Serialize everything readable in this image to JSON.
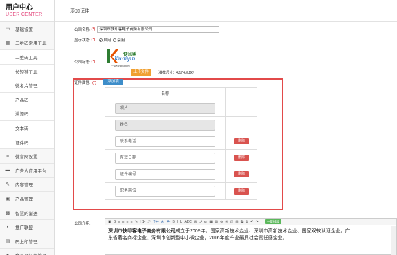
{
  "sidebar": {
    "brand_title": "用户中心",
    "brand_sub": "USER CENTER",
    "items": [
      {
        "label": "基础设置",
        "icon": "monitor-icon",
        "sub": false
      },
      {
        "label": "二维码常用工具",
        "icon": "grid-icon",
        "sub": false
      },
      {
        "label": "二维码工具",
        "icon": "",
        "sub": true
      },
      {
        "label": "长短链工具",
        "icon": "",
        "sub": true
      },
      {
        "label": "微名片管理",
        "icon": "",
        "sub": true
      },
      {
        "label": "产品码",
        "icon": "",
        "sub": true
      },
      {
        "label": "溯源码",
        "icon": "",
        "sub": true
      },
      {
        "label": "文本码",
        "icon": "",
        "sub": true
      },
      {
        "label": "证件码",
        "icon": "",
        "sub": true
      },
      {
        "label": "微官网设置",
        "icon": "list-icon",
        "sub": false
      },
      {
        "label": "广告人应用平台",
        "icon": "book-icon",
        "sub": false
      },
      {
        "label": "内容管理",
        "icon": "edit-icon",
        "sub": false
      },
      {
        "label": "产品管理",
        "icon": "image-icon",
        "sub": false
      },
      {
        "label": "智慧的渐进",
        "icon": "gift-icon",
        "sub": false
      },
      {
        "label": "推广联盟",
        "icon": "lock-icon",
        "sub": false
      },
      {
        "label": "码上印管理",
        "icon": "doc-icon",
        "sub": false
      },
      {
        "label": "会员及证件管理",
        "icon": "user-icon",
        "sub": false
      }
    ]
  },
  "main": {
    "header_title": "添加证件",
    "company_name_label": "公司名称:",
    "required_mark": "(*)",
    "company_name_value": "深圳市快印客电子商务有限公司",
    "display_status_label": "显示状态:",
    "status_enabled": "启用",
    "status_disabled": "禁用",
    "logo_label": "公司标志:",
    "logo_brand": "Kuaiyinke",
    "logo_brand_cn": "快印客",
    "logo_tagline": "一站式全网印刷服务",
    "upload_label": "上传文件",
    "logo_hint": "（推荐尺寸：430*430px）",
    "attr_label": "证件属性:",
    "add_attr_label": "添加项",
    "attr_table_header": "名称",
    "attr_rows": [
      {
        "name": "照片",
        "locked": true,
        "delete_label": ""
      },
      {
        "name": "姓名",
        "locked": true,
        "delete_label": ""
      },
      {
        "name": "联系电话",
        "locked": false,
        "delete_label": "删除"
      },
      {
        "name": "有效日期",
        "locked": false,
        "delete_label": "删除"
      },
      {
        "name": "证件编号",
        "locked": false,
        "delete_label": "删除"
      },
      {
        "name": "职务岗位",
        "locked": false,
        "delete_label": "删除"
      }
    ],
    "intro_label": "公司介绍:",
    "editor_toolbar": [
      "▣",
      "B̲",
      "≡",
      "≡",
      "≡",
      "≡",
      "✎",
      "H1-",
      "ℱ-",
      "T+-",
      "A-",
      "A̲-",
      "B",
      "I",
      "U",
      "ABC",
      "⊞",
      "x²",
      "x₂",
      "▦",
      "▤",
      "⊕",
      "✉",
      "⊡",
      "⊟",
      "⧉",
      "⚙",
      "↶",
      "↷"
    ],
    "editor_green_label": "一键排版",
    "editor_company": "深圳市快印客电子商务有限公司",
    "editor_text_1": "成立于2009年。国家高新技术企业、深圳市高新技术企业、国家双软认证企业，广",
    "editor_text_2": "东省著名商标企业、深圳市创新型中小微企业，2016年度产业最具社会责任感企业。"
  },
  "colors": {
    "accent_pink": "#e3457b",
    "upload_orange": "#f0a030",
    "add_blue": "#3d8dc9",
    "delete_red": "#d9534f",
    "frame_red": "#e24a4a",
    "green": "#5cb85c"
  }
}
